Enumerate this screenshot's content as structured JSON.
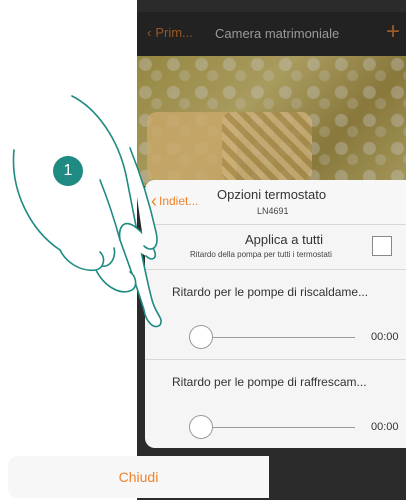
{
  "navbar": {
    "back_label": "Prim...",
    "title": "Camera matrimoniale",
    "add_label": "+"
  },
  "sheet": {
    "back_label": "Indiet...",
    "title": "Opzioni termostato",
    "subtitle": "LN4691",
    "apply_all": {
      "title": "Applica a tutti",
      "description": "Ritardo della pompa per tutti i termostati",
      "checked": false
    },
    "sliders": [
      {
        "label": "Ritardo per le pompe di riscaldame...",
        "value": "00:00",
        "fraction": 0
      },
      {
        "label": "Ritardo per le pompe di raffrescam...",
        "value": "00:00",
        "fraction": 0
      }
    ]
  },
  "close_label": "Chiudi",
  "step_number": "1",
  "colors": {
    "accent": "#f0822b",
    "step_badge": "#1f8a82"
  }
}
